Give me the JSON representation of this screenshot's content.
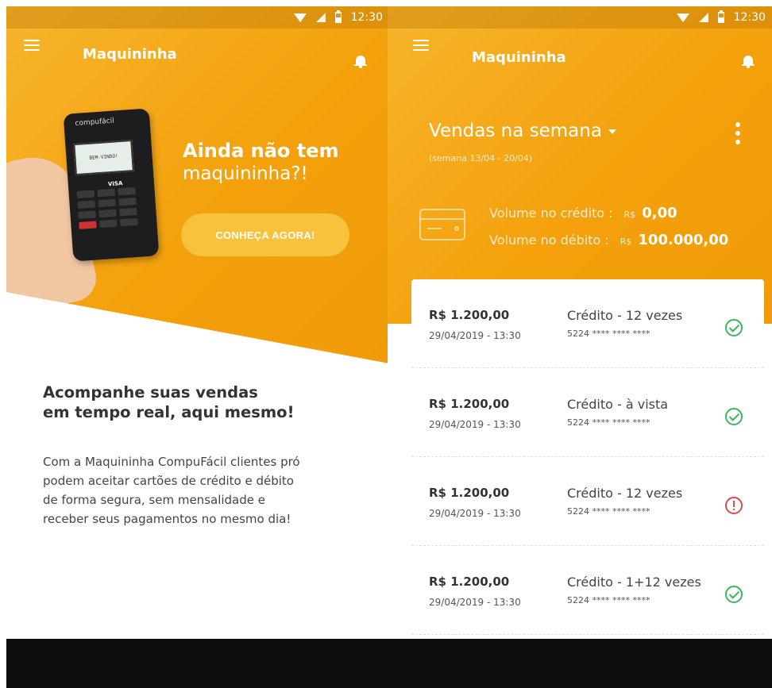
{
  "status_bar": {
    "time": "12:30"
  },
  "left": {
    "app_title": "Maquininha",
    "device": {
      "brand": "compufácil",
      "screen_text": "BEM-VINDO!",
      "card_brands": "VISA"
    },
    "hero": {
      "title_line1": "Ainda não tem",
      "title_line2": "maquininha?!",
      "cta_label": "CONHEÇA AGORA!"
    },
    "headline": {
      "line1": "Acompanhe suas vendas",
      "line2": "em tempo real, aqui mesmo!"
    },
    "body_lines": [
      "Com a Maquininha CompuFácil clientes pró",
      "podem aceitar cartões de crédito e débito",
      "de forma segura, sem mensalidade e",
      "receber seus pagamentos no mesmo dia!"
    ]
  },
  "right": {
    "app_title": "Maquininha",
    "week_title": "Vendas na semana",
    "week_subtitle": "(semana 13/04 - 20/04)",
    "volumes": {
      "credit_label": "Volume no crédito :",
      "credit_currency": "R$",
      "credit_value": "0,00",
      "debit_label": "Volume no débito :",
      "debit_currency": "R$",
      "debit_value": "100.000,00"
    },
    "transactions": [
      {
        "amount": "R$ 1.200,00",
        "date": "29/04/2019 - 13:30",
        "method": "Crédito - 12 vezes",
        "card": "5224 **** **** ****",
        "status": "approved",
        "status_icon": "check-circle-icon"
      },
      {
        "amount": "R$ 1.200,00",
        "date": "29/04/2019 - 13:30",
        "method": "Crédito - à vista",
        "card": "5224 **** **** ****",
        "status": "approved",
        "status_icon": "check-circle-icon"
      },
      {
        "amount": "R$ 1.200,00",
        "date": "29/04/2019 - 13:30",
        "method": "Crédito - 12 vezes",
        "card": "5224 **** **** ****",
        "status": "error",
        "status_icon": "alert-circle-icon"
      },
      {
        "amount": "R$ 1.200,00",
        "date": "29/04/2019 - 13:30",
        "method": "Crédito - 1+12 vezes",
        "card": "5224 **** **** ****",
        "status": "approved",
        "status_icon": "check-circle-icon"
      }
    ]
  },
  "colors": {
    "brand_orange": "#f4a10c",
    "cta_yellow": "#f8c23d",
    "success_green": "#3db85a",
    "error_red": "#e34848"
  }
}
